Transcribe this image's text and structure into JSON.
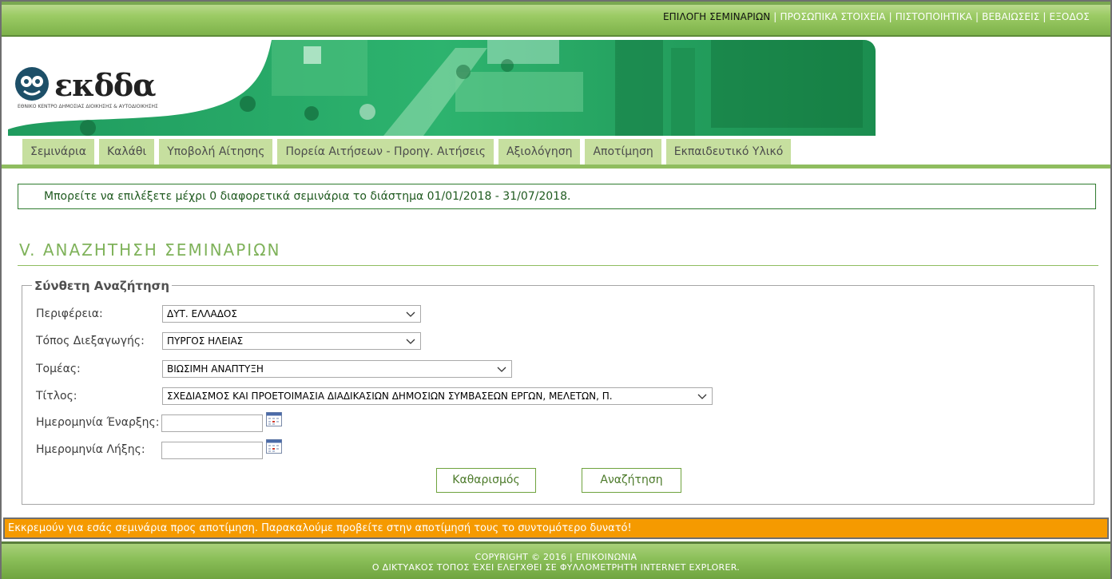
{
  "top_nav": {
    "items": [
      {
        "label": "ΕΠΙΛΟΓΗ ΣΕΜΙΝΑΡΙΩΝ",
        "active": true
      },
      {
        "label": "ΠΡΟΣΩΠΙΚΑ ΣΤΟΙΧΕΙΑ",
        "active": false
      },
      {
        "label": "ΠΙΣΤΟΠΟΙΗΤΙΚΑ",
        "active": false
      },
      {
        "label": "ΒΕΒΑΙΩΣΕΙΣ",
        "active": false
      },
      {
        "label": "ΕΞΟΔΟΣ",
        "active": false
      }
    ],
    "separator": "|"
  },
  "logo": {
    "word": "εκδδα",
    "subtitle": "ΕΘΝΙΚΟ ΚΕΝΤΡΟ ΔΗΜΟΣΙΑΣ ΔΙΟΙΚΗΣΗΣ & ΑΥΤΟΔΙΟΙΚΗΣΗΣ"
  },
  "tabs": [
    "Σεμινάρια",
    "Καλάθι",
    "Υποβολή Αίτησης",
    "Πορεία Αιτήσεων - Προηγ. Αιτήσεις",
    "Αξιολόγηση",
    "Αποτίμηση",
    "Εκπαιδευτικό Υλικό"
  ],
  "info_message": "Μπορείτε να επιλέξετε μέχρι 0 διαφορετικά σεμινάρια το διάστημα 01/01/2018 - 31/07/2018.",
  "section_heading": "V. ΑΝΑΖΗΤΗΣΗ ΣΕΜΙΝΑΡΙΩΝ",
  "search_form": {
    "legend": "Σύνθετη Αναζήτηση",
    "region_label": "Περιφέρεια:",
    "region_value": "ΔΥΤ. ΕΛΛΑΔΟΣ",
    "venue_label": "Τόπος Διεξαγωγής:",
    "venue_value": "ΠΥΡΓΟΣ ΗΛΕΙΑΣ",
    "sector_label": "Τομέας:",
    "sector_value": "ΒΙΩΣΙΜΗ ΑΝΑΠΤΥΞΗ",
    "title_label": "Τίτλος:",
    "title_value": "ΣΧΕΔΙΑΣΜΟΣ ΚΑΙ ΠΡΟΕΤΟΙΜΑΣΙΑ ΔΙΑΔΙΚΑΣΙΩΝ ΔΗΜΟΣΙΩΝ ΣΥΜΒΑΣΕΩΝ ΕΡΓΩΝ, ΜΕΛΕΤΩΝ, Π.",
    "start_date_label": "Ημερομηνία Έναρξης:",
    "start_date_value": "",
    "end_date_label": "Ημερομηνία Λήξης:",
    "end_date_value": "",
    "clear_button": "Καθαρισμός",
    "search_button": "Αναζήτηση"
  },
  "alert_message": "Εκκρεμούν για εσάς σεμινάρια προς αποτίμηση. Παρακαλούμε προβείτε στην αποτίμησή τους το συντομότερο δυνατό!",
  "footer": {
    "line1": "COPYRIGHT © 2016 | ΕΠΙΚΟΙΝΩΝΙΑ",
    "line2": "Ο ΔΙΚΤΥΑΚΟΣ ΤΟΠΟΣ ΈΧΕΙ ΕΛΕΓΧΘΕΙ ΣΕ ΦΥΛΛΟΜΕΤΡΗΤΉ INTERNET EXPLORER."
  },
  "colors": {
    "brand_green": "#7fb25a",
    "tab_bg": "#c6df9f",
    "alert_orange": "#f59a00",
    "info_border": "#2f7b2f"
  }
}
